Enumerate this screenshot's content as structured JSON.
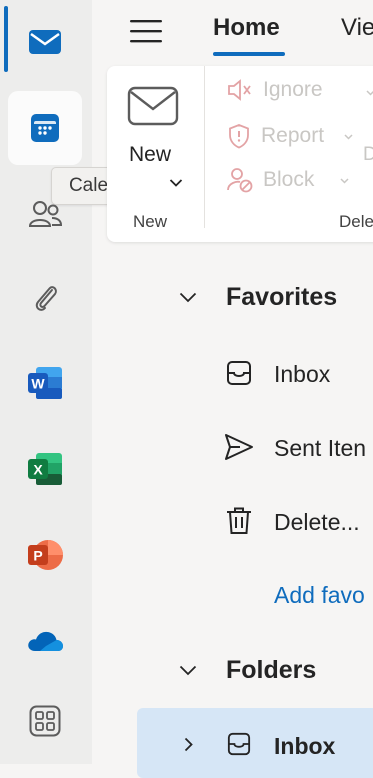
{
  "rail": {
    "items": [
      {
        "icon": "mail-icon",
        "selected": true
      },
      {
        "icon": "calendar-icon",
        "hovered": true
      },
      {
        "icon": "people-icon"
      },
      {
        "icon": "attachment-icon"
      },
      {
        "icon": "word-icon",
        "letter": "W"
      },
      {
        "icon": "excel-icon",
        "letter": "X"
      },
      {
        "icon": "powerpoint-icon",
        "letter": "P"
      },
      {
        "icon": "onedrive-icon"
      },
      {
        "icon": "apps-icon"
      }
    ],
    "tooltip": "Calendar"
  },
  "header": {
    "tabs": [
      {
        "label": "Home",
        "active": true
      },
      {
        "label": "Vie"
      }
    ]
  },
  "ribbon": {
    "new_label": "New",
    "group_new": "New",
    "ignore_label": "Ignore",
    "report_label": "Report",
    "block_label": "Block",
    "d_fragment": "D",
    "group_delete": "Dele"
  },
  "nav": {
    "favorites": {
      "title": "Favorites",
      "items": [
        {
          "label": "Inbox",
          "icon": "inbox-icon"
        },
        {
          "label": "Sent Iten",
          "icon": "send-icon"
        },
        {
          "label": "Delete...",
          "icon": "trash-icon"
        }
      ],
      "add_link": "Add favo"
    },
    "folders": {
      "title": "Folders",
      "items": [
        {
          "label": "Inbox",
          "icon": "inbox-icon",
          "selected": true
        }
      ]
    }
  },
  "colors": {
    "accent": "#0f6cbd",
    "selected_row": "#d6e6f6",
    "word": "#185abd",
    "excel": "#107c41",
    "powerpoint": "#c43e1c",
    "onedrive": "#0364b8"
  }
}
